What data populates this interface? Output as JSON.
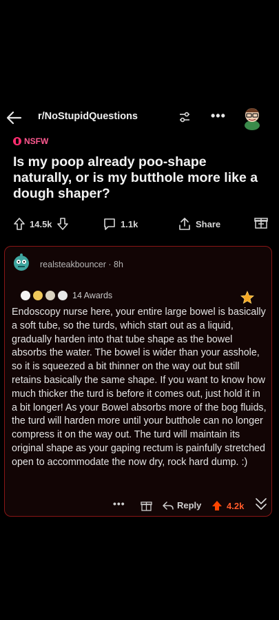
{
  "header": {
    "subreddit": "r/NoStupidQuestions",
    "more_label": "•••",
    "icons": [
      "back-arrow-icon",
      "filter-icon",
      "snoo-avatar-icon"
    ]
  },
  "post": {
    "nsfw_label": "NSFW",
    "title": "Is my poop already poo-shape naturally, or is my butthole more like a dough shaper?",
    "upvotes": "14.5k",
    "comments": "1.1k",
    "share_label": "Share"
  },
  "comment": {
    "author": "realsteakbouncer",
    "separator": "·",
    "age": "8h",
    "awards_label": "14 Awards",
    "body": "Endoscopy nurse here, your entire large bowel is basically a soft tube, so the turds, which start out as a liquid, gradually harden into that tube shape as the bowel absorbs the water. The bowel is wider than your asshole, so it is squeezed a bit thinner on the way out but still retains basically the same shape. If you want to know how much thicker the turd is before it comes out, just hold it in a bit longer! As your Bowel absorbs more of the bog fluids, the turd will harden more until your butthole can no longer compress it on the way out. The turd will maintain its original shape as your gaping rectum is painfully stretched open to accommodate the now dry, rock hard dump. :)",
    "more_label": "•••",
    "reply_label": "Reply",
    "score": "4.2k"
  },
  "colors": {
    "background": "#000000",
    "nsfw": "#ff2d6f",
    "comment_border": "#8a1616",
    "upvote": "#ff4500"
  }
}
